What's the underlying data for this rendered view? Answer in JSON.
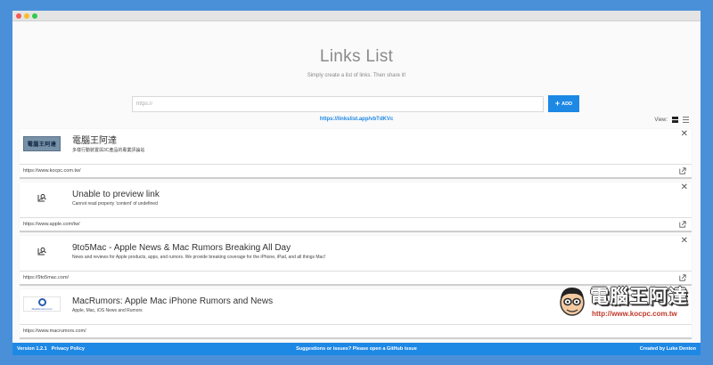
{
  "window": {
    "title": ""
  },
  "header": {
    "title": "Links List",
    "subtitle": "Simply create a list of links. Then share it!"
  },
  "form": {
    "input_placeholder": "https://",
    "add_label": "ADD",
    "add_icon": "plus-icon"
  },
  "share": {
    "url": "https://linkslist.app/vbTdKVc"
  },
  "view": {
    "label": "View:",
    "options": [
      "grid-view-icon",
      "list-view-icon"
    ],
    "selected": "grid-view-icon"
  },
  "links": [
    {
      "thumb": "kocpc-logo",
      "thumb_text": "電腦王阿達",
      "title": "電腦王阿達",
      "description": "多樣行動裝置與3C產品的專業評論站",
      "url": "https://www.kocpc.com.tw/"
    },
    {
      "thumb": "image-search-icon",
      "title": "Unable to preview link",
      "description": "Cannot read property 'content' of undefined",
      "url": "https://www.apple.com/tw/"
    },
    {
      "thumb": "image-search-icon",
      "title": "9to5Mac - Apple News & Mac Rumors Breaking All Day",
      "description": "News and reviews for Apple products, apps, and rumors. We provide breaking coverage for the iPhone, iPad, and all things Mac!",
      "url": "https://9to5mac.com/"
    },
    {
      "thumb": "macrumors-logo",
      "thumb_text": "MacRumors.com",
      "title": "MacRumors: Apple Mac iPhone Rumors and News",
      "description": "Apple, Mac, iOS News and Rumors",
      "url": "https://www.macrumors.com/"
    }
  ],
  "footer": {
    "version": "Version 1.2.1",
    "privacy": "Privacy Policy",
    "suggestions": "Suggestions or issues? Please open a GitHub issue",
    "credit": "Created by Luke Denton"
  },
  "watermark": {
    "text": "電腦王阿達",
    "url": "http://www.kocpc.com.tw"
  },
  "colors": {
    "accent": "#1e88e5",
    "background": "#4a90d9"
  }
}
